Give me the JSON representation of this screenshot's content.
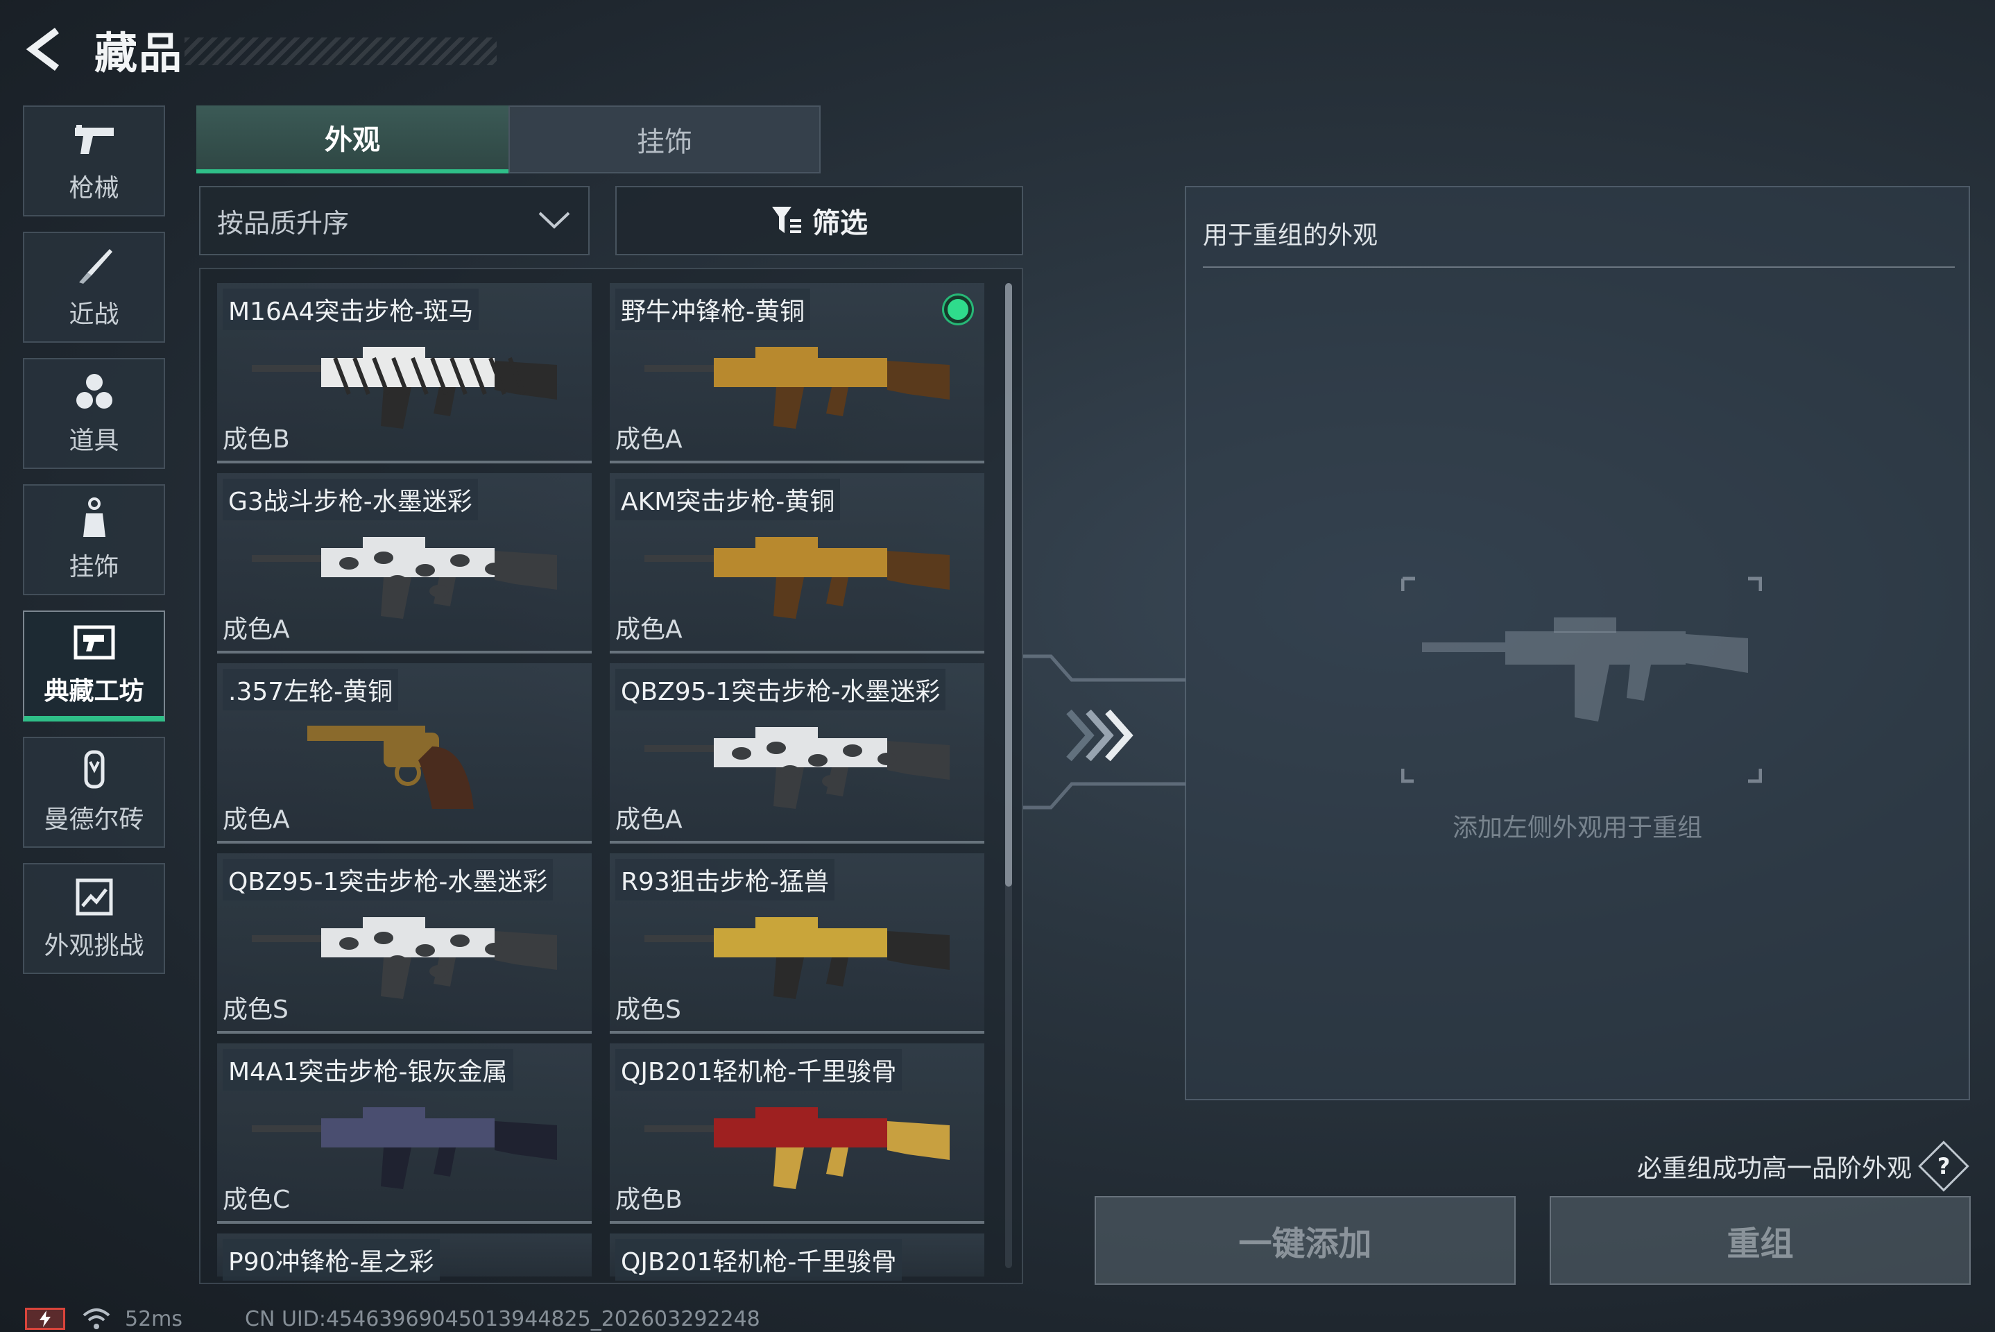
{
  "header": {
    "title": "藏品"
  },
  "sidebar": {
    "items": [
      {
        "label": "枪械",
        "icon": "pistol-icon"
      },
      {
        "label": "近战",
        "icon": "knife-icon"
      },
      {
        "label": "道具",
        "icon": "grenades-icon"
      },
      {
        "label": "挂饰",
        "icon": "charm-icon"
      },
      {
        "label": "典藏工坊",
        "icon": "workshop-icon",
        "active": true
      },
      {
        "label": "曼德尔砖",
        "icon": "brick-icon"
      },
      {
        "label": "外观挑战",
        "icon": "challenge-icon"
      }
    ]
  },
  "tabs": [
    {
      "label": "外观",
      "active": true
    },
    {
      "label": "挂饰",
      "active": false
    }
  ],
  "sort": {
    "label": "按品质升序"
  },
  "filter": {
    "label": "筛选"
  },
  "items": [
    {
      "name": "M16A4突击步枪-斑马",
      "grade": "成色B",
      "skin": "zebra"
    },
    {
      "name": "野牛冲锋枪-黄铜",
      "grade": "成色A",
      "skin": "brass",
      "selected": true
    },
    {
      "name": "G3战斗步枪-水墨迷彩",
      "grade": "成色A",
      "skin": "ink"
    },
    {
      "name": "AKM突击步枪-黄铜",
      "grade": "成色A",
      "skin": "brass"
    },
    {
      "name": ".357左轮-黄铜",
      "grade": "成色A",
      "skin": "revolver"
    },
    {
      "name": "QBZ95-1突击步枪-水墨迷彩",
      "grade": "成色A",
      "skin": "ink"
    },
    {
      "name": "QBZ95-1突击步枪-水墨迷彩",
      "grade": "成色S",
      "skin": "ink"
    },
    {
      "name": "R93狙击步枪-猛兽",
      "grade": "成色S",
      "skin": "beast"
    },
    {
      "name": "M4A1突击步枪-银灰金属",
      "grade": "成色C",
      "skin": "metal"
    },
    {
      "name": "QJB201轻机枪-千里骏骨",
      "grade": "成色B",
      "skin": "red"
    },
    {
      "name": "P90冲锋枪-星之彩",
      "grade": "",
      "skin": "none"
    },
    {
      "name": "QJB201轻机枪-千里骏骨",
      "grade": "",
      "skin": "none"
    }
  ],
  "recombine_panel": {
    "title": "用于重组的外观",
    "placeholder": "添加左侧外观用于重组"
  },
  "hint": "必重组成功高一品阶外观",
  "buttons": {
    "add_all": "一键添加",
    "recombine": "重组"
  },
  "status": {
    "ping": "52ms",
    "uid": "CN UID:45463969045013944825_202603292248"
  },
  "colors": {
    "accent": "#2fbf88",
    "selected_dot": "#2fdc8c"
  }
}
